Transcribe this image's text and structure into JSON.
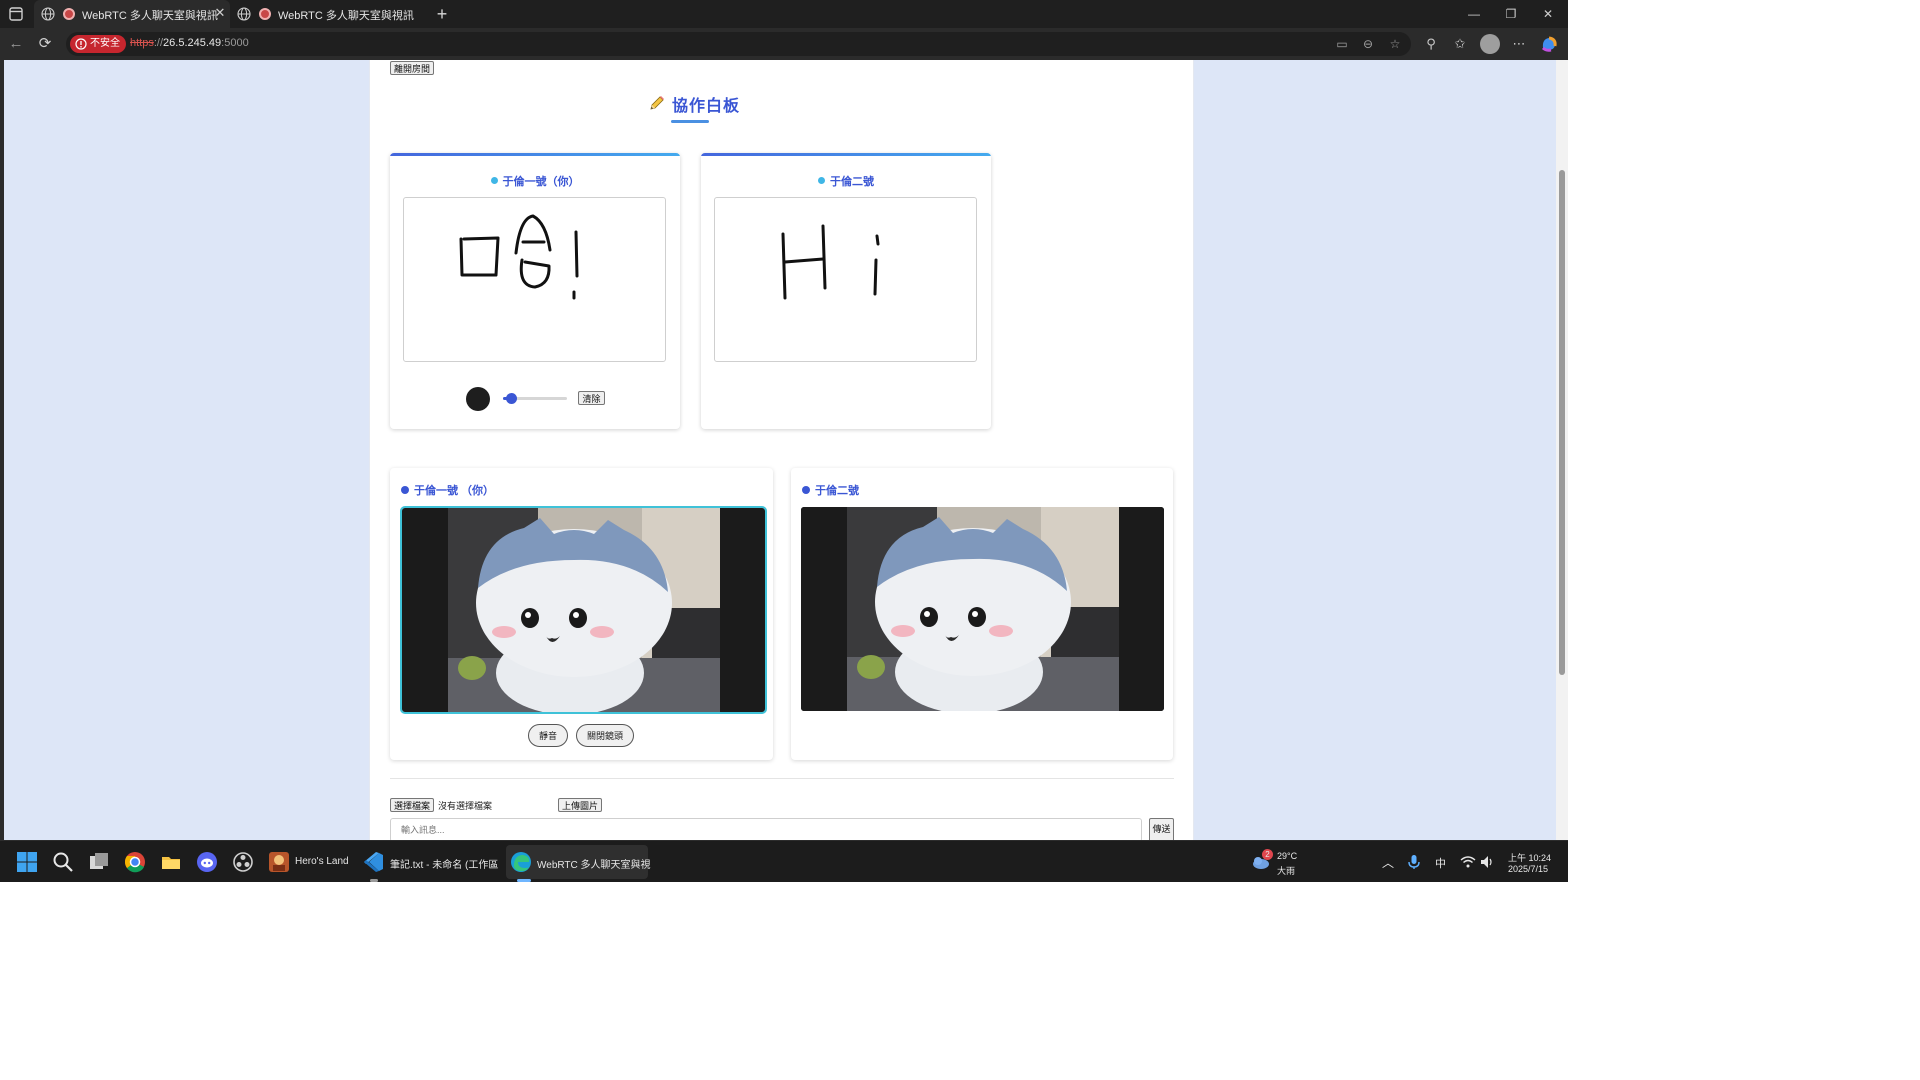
{
  "browser": {
    "tabs": [
      {
        "title": "WebRTC 多人聊天室與視訊",
        "active": true
      },
      {
        "title": "WebRTC 多人聊天室與視訊",
        "active": false
      }
    ],
    "new_tab_icon": "plus-icon",
    "security_badge": "不安全",
    "url_protocol": "https",
    "url_separator": "://",
    "url_host": "26.5.245.49",
    "url_port": ":5000"
  },
  "page": {
    "leave_room_label": "離開房間",
    "whiteboard_title": "協作白板",
    "whiteboard_icon": "pencil-icon",
    "accent_color": "#3a56d4",
    "whiteboards": [
      {
        "user": "于倫一號（你）",
        "drawing": "哈!"
      },
      {
        "user": "于倫二號",
        "drawing": "Hi"
      }
    ],
    "clear_label": "清除",
    "brush_color": "#1e1e1e",
    "brush_size_fraction": 0.12,
    "videos": [
      {
        "user": "于倫一號 （你）"
      },
      {
        "user": "于倫二號"
      }
    ],
    "mute_label": "靜音",
    "camera_off_label": "關閉鏡頭",
    "choose_file_label": "選擇檔案",
    "no_file_label": "沒有選擇檔案",
    "upload_image_label": "上傳圖片",
    "message_placeholder": "輸入訊息...",
    "send_label": "傳送"
  },
  "taskbar": {
    "apps": [
      {
        "name": "Hero's Land"
      },
      {
        "name": "筆記.txt - 未命名 (工作區"
      },
      {
        "name": "WebRTC 多人聊天室與視"
      }
    ],
    "weather_badge": "2",
    "weather_temp": "29°C",
    "weather_desc": "大雨",
    "ime": "中",
    "time": "上午 10:24",
    "date": "2025/7/15"
  }
}
